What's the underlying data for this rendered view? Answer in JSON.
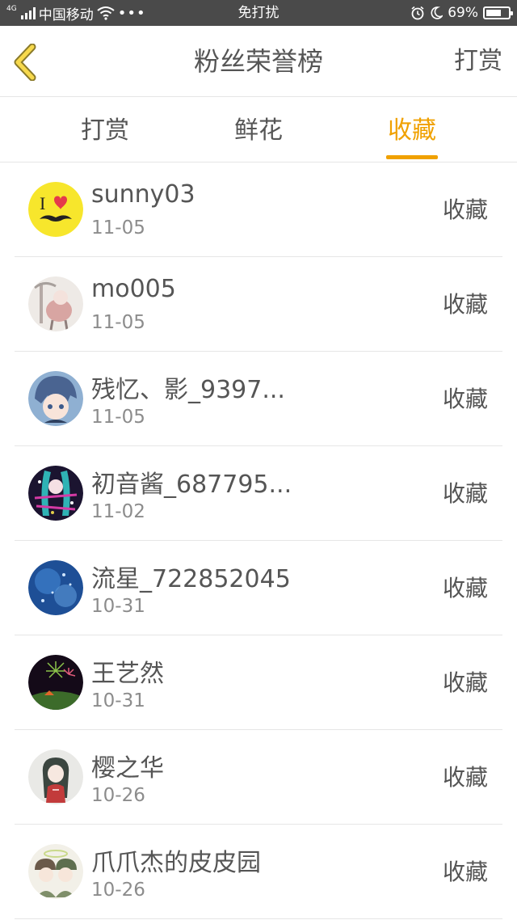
{
  "status_bar": {
    "network": "4G",
    "carrier": "中国移动",
    "center_label": "免打扰",
    "battery_percent": "69%",
    "battery_level": 0.69
  },
  "header": {
    "title": "粉丝荣誉榜",
    "right_action": "打赏",
    "back_icon": "chevron-left-icon"
  },
  "tabs": [
    {
      "label": "打赏",
      "active": false
    },
    {
      "label": "鲜花",
      "active": false
    },
    {
      "label": "收藏",
      "active": true
    }
  ],
  "accent_color": "#f0a100",
  "fans": [
    {
      "name": "sunny03",
      "date": "11-05",
      "action": "收藏"
    },
    {
      "name": "mo005",
      "date": "11-05",
      "action": "收藏"
    },
    {
      "name": "残忆、影_9397...",
      "date": "11-05",
      "action": "收藏"
    },
    {
      "name": "初音酱_687795...",
      "date": "11-02",
      "action": "收藏"
    },
    {
      "name": "流星_722852045",
      "date": "10-31",
      "action": "收藏"
    },
    {
      "name": "王艺然",
      "date": "10-31",
      "action": "收藏"
    },
    {
      "name": "樱之华",
      "date": "10-26",
      "action": "收藏"
    },
    {
      "name": "爪爪杰的皮皮园",
      "date": "10-26",
      "action": "收藏"
    }
  ]
}
